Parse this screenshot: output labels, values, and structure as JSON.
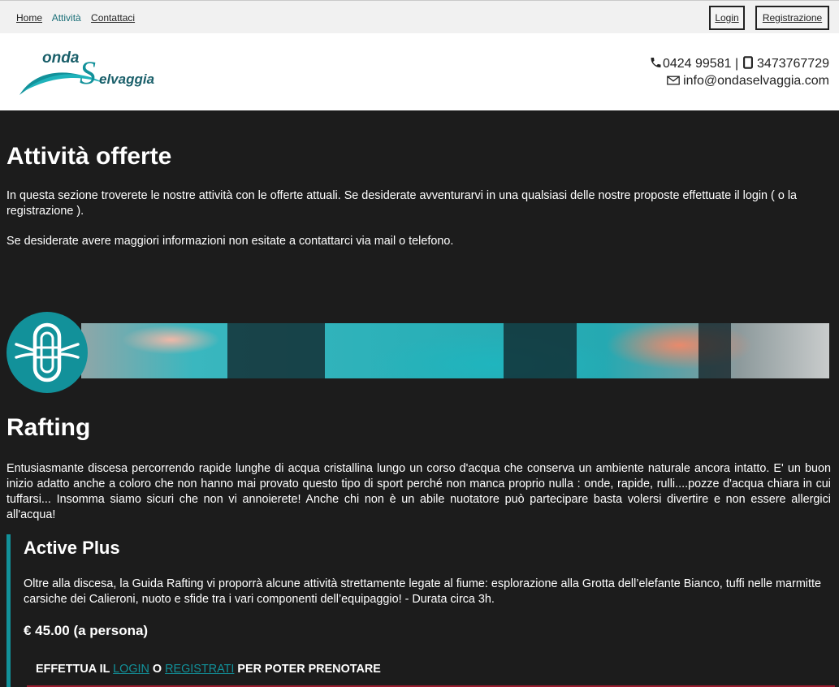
{
  "nav": {
    "home": "Home",
    "activities": "Attività",
    "contacts": "Contattaci",
    "login": "Login",
    "register": "Registrazione"
  },
  "brand": {
    "logo_word1": "onda",
    "logo_word2": "elvaggia",
    "logo_initial": "S",
    "accent_color": "#12919a"
  },
  "contact": {
    "phone": "0424 99581",
    "separator": "|",
    "mobile": "3473767729",
    "email": "info@ondaselvaggia.com"
  },
  "page": {
    "title": "Attività offerte",
    "intro_1": "In questa sezione troverete le nostre attività con le offerte attuali. Se desiderate avventurarvi in una qualsiasi delle nostre proposte effettuate il login ( o la registrazione ).",
    "intro_2": "Se desiderate avere maggiori informazioni non esitate a contattarci via mail o telefono."
  },
  "section": {
    "icon": "raft-icon",
    "title": "Rafting",
    "description": "Entusiasmante discesa percorrendo rapide lunghe di acqua cristallina lungo un corso d'acqua che conserva un ambiente naturale ancora intatto. E' un buon inizio adatto anche a coloro che non hanno mai provato questo tipo di sport perché non manca proprio nulla : onde, rapide, rulli....pozze d'acqua chiara in cui tuffarsi... Insomma siamo sicuri che non vi annoierete! Anche chi non è un abile nuotatore può partecipare basta volersi divertire e non essere allergici all'acqua!"
  },
  "offer": {
    "title": "Active Plus",
    "description": "Oltre alla discesa, la Guida Rafting vi proporrà alcune attività strettamente legate al fiume: esplorazione alla Grotta dell’elefante Bianco, tuffi nelle marmitte carsiche dei Calieroni, nuoto e sfide tra i vari componenti dell’equipaggio! - Durata circa 3h.",
    "price": "€ 45.00 (a persona)",
    "booking_prefix": "EFFETTUA IL",
    "booking_login": "LOGIN",
    "booking_or": "O",
    "booking_register": "REGISTRATI",
    "booking_suffix": "PER POTER PRENOTARE"
  }
}
